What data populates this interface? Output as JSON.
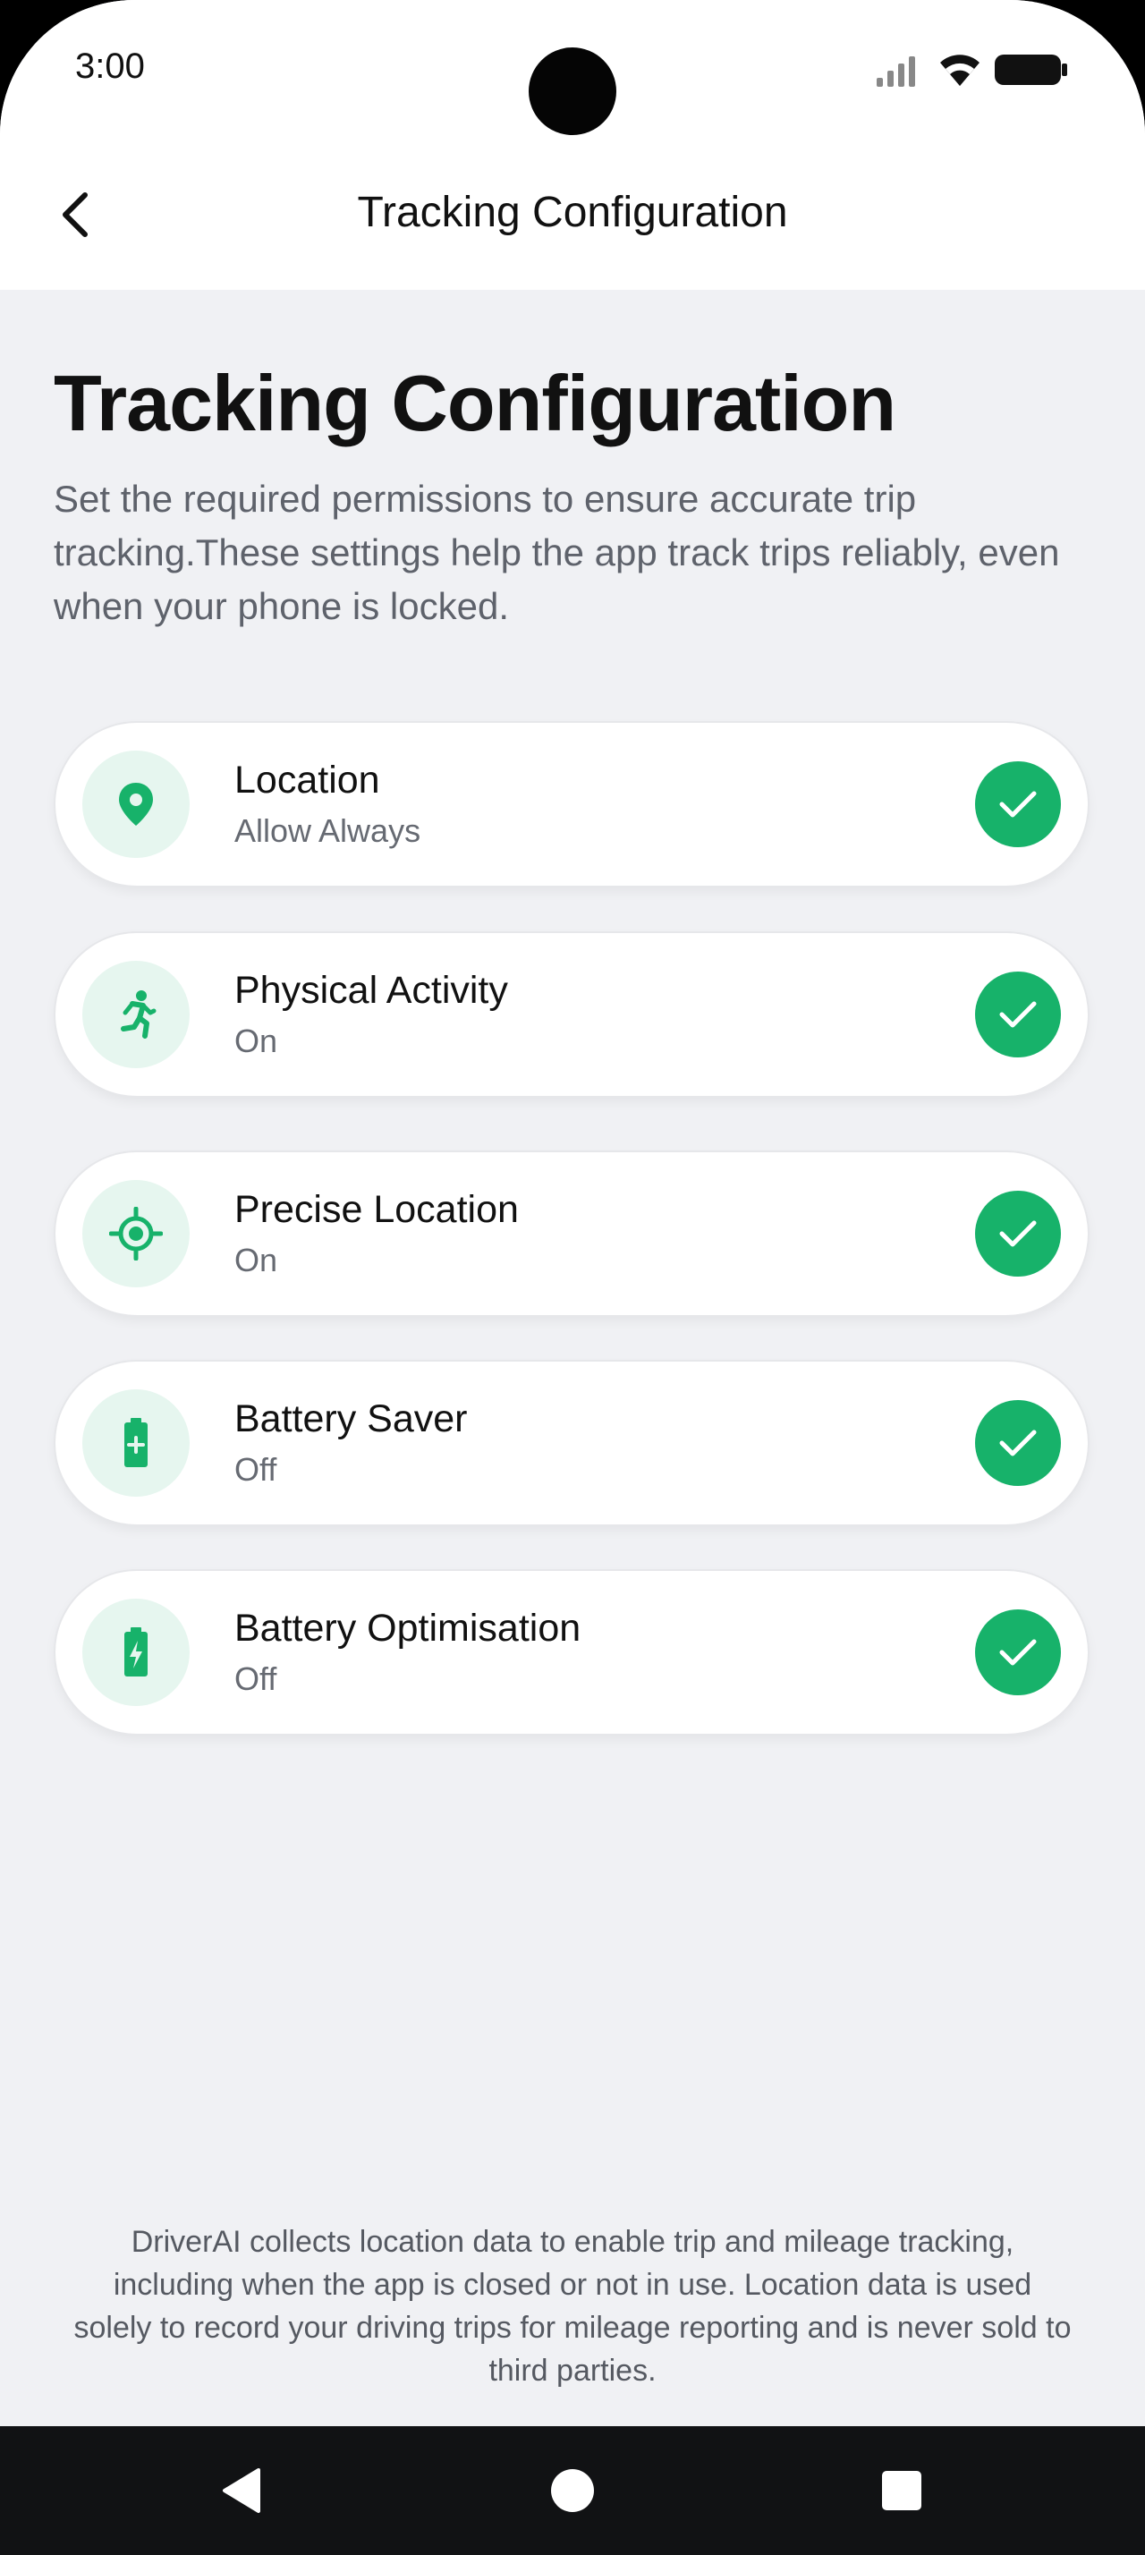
{
  "status_bar": {
    "time": "3:00"
  },
  "header": {
    "title": "Tracking Configuration"
  },
  "main": {
    "title": "Tracking Configuration",
    "description": "Set the required permissions to ensure accurate trip tracking.These settings help the app track trips reliably, even when your phone is locked.",
    "items": [
      {
        "label": "Location",
        "status": "Allow Always",
        "icon": "location-pin-icon",
        "checked": true
      },
      {
        "label": "Physical Activity",
        "status": "On",
        "icon": "running-person-icon",
        "checked": true
      },
      {
        "label": "Precise Location",
        "status": "On",
        "icon": "gps-target-icon",
        "checked": true
      },
      {
        "label": "Battery Saver",
        "status": "Off",
        "icon": "battery-plus-icon",
        "checked": true
      },
      {
        "label": "Battery Optimisation",
        "status": "Off",
        "icon": "battery-bolt-icon",
        "checked": true
      }
    ]
  },
  "footer": {
    "disclaimer": "DriverAI collects location data to enable trip and mileage tracking, including when the app is closed or not in use. Location data is used solely to record your driving trips for mileage reporting and is never sold to third parties."
  },
  "colors": {
    "accent": "#17b26a",
    "icon_bg": "#e6f6ef",
    "background": "#f0f1f4"
  }
}
